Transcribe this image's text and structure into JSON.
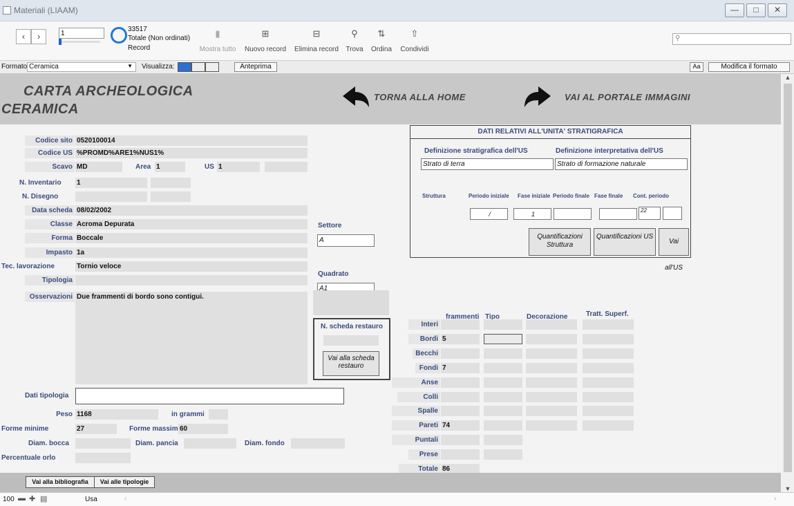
{
  "window": {
    "title": "Materiali (LIAAM)"
  },
  "toolbar": {
    "record_number": "1",
    "record_total": "33517",
    "record_status": "Totale (Non ordinati)",
    "record_label": "Record",
    "show_all": "Mostra tutto",
    "new_record": "Nuovo record",
    "delete_record": "Elimina record",
    "find": "Trova",
    "sort": "Ordina",
    "share": "Condividi",
    "search_placeholder": ""
  },
  "formatbar": {
    "format_label": "Formato:",
    "format_value": "Ceramica",
    "view_label": "Visualizza:",
    "preview": "Anteprima",
    "aa": "Aa",
    "edit_layout": "Modifica il formato"
  },
  "header": {
    "title_line1": "Carta archeologica",
    "title_line2": "Ceramica",
    "home_link": "Torna alla Home",
    "images_link": "Vai al portale Immagini"
  },
  "form": {
    "codice_sito_label": "Codice sito",
    "codice_sito": "0520100014",
    "codice_us_label": "Codice US",
    "codice_us": "%PROMD%ARE1%NUS1%",
    "scavo_label": "Scavo",
    "scavo": "MD",
    "area_label": "Area",
    "area": "1",
    "us_label": "US",
    "us": "1",
    "inventario_label": "N. Inventario",
    "inventario": "1",
    "disegno_label": "N. Disegno",
    "data_label": "Data scheda",
    "data": "08/02/2002",
    "classe_label": "Classe",
    "classe": "Acroma Depurata",
    "forma_label": "Forma",
    "forma": "Boccale",
    "impasto_label": "Impasto",
    "impasto": "1a",
    "lavorazione_label": "Tec. lavorazione",
    "lavorazione": "Tornio veloce",
    "tipologia_label": "Tipologia",
    "osservazioni_label": "Osservazioni",
    "osservazioni": "Due frammenti di bordo sono contigui.",
    "settore_label": "Settore",
    "settore": "A",
    "quadrato_label": "Quadrato",
    "quadrato": "A1",
    "restauro_label": "N. scheda restauro",
    "restauro_button": "Vai alla scheda restauro",
    "dati_tipologia_label": "Dati tipologia",
    "peso_label": "Peso",
    "peso": "1168",
    "grammi": "in grammi",
    "forme_minime_label": "Forme minime",
    "forme_minime": "27",
    "forme_massime_label": "Forme massime",
    "forme_massime": "60",
    "diam_bocca_label": "Diam. bocca",
    "diam_pancia_label": "Diam. pancia",
    "diam_fondo_label": "Diam. fondo",
    "orlo_label": "Percentuale orlo"
  },
  "us_panel": {
    "title": "DATI RELATIVI ALL'UNITA' STRATIGRAFICA",
    "def_strat_label": "Definizione stratigrafica dell'US",
    "def_interp_label": "Definizione interpretativa dell'US",
    "def_strat": "Strato di terra",
    "def_interp": "Strato di formazione naturale",
    "struttura": "Struttura",
    "periodo_iniziale": "Periodo iniziale",
    "fase_iniziale": "Fase iniziale",
    "periodo_finale": "Periodo finale",
    "fase_finale": "Fase finale",
    "cont_periodo": "Cont. periodo",
    "val_periodo_iniziale": "/",
    "val_fase_iniziale": "1",
    "val_cont": "22",
    "btn_quant_struttura": "Quantificazioni Struttura",
    "btn_quant_us": "Quantificazioni US",
    "btn_vai_us": "Vai all'US"
  },
  "fragments": {
    "headers": [
      "frammenti",
      "Tipo",
      "Decorazione",
      "Tratt. Superf."
    ],
    "rows": [
      {
        "label": "Interi",
        "value": ""
      },
      {
        "label": "Bordi",
        "value": "5"
      },
      {
        "label": "Becchi",
        "value": ""
      },
      {
        "label": "Fondi",
        "value": "7"
      },
      {
        "label": "Anse",
        "value": ""
      },
      {
        "label": "Colli",
        "value": ""
      },
      {
        "label": "Spalle",
        "value": ""
      },
      {
        "label": "Pareti",
        "value": "74"
      },
      {
        "label": "Puntali",
        "value": ""
      },
      {
        "label": "Prese",
        "value": ""
      },
      {
        "label": "Totale",
        "value": "86"
      }
    ]
  },
  "footer": {
    "bibliografia": "Vai alla bibliografia",
    "tipologie": "Vai alle tipologie"
  },
  "status": {
    "zoom": "100",
    "mode": "Usa"
  }
}
